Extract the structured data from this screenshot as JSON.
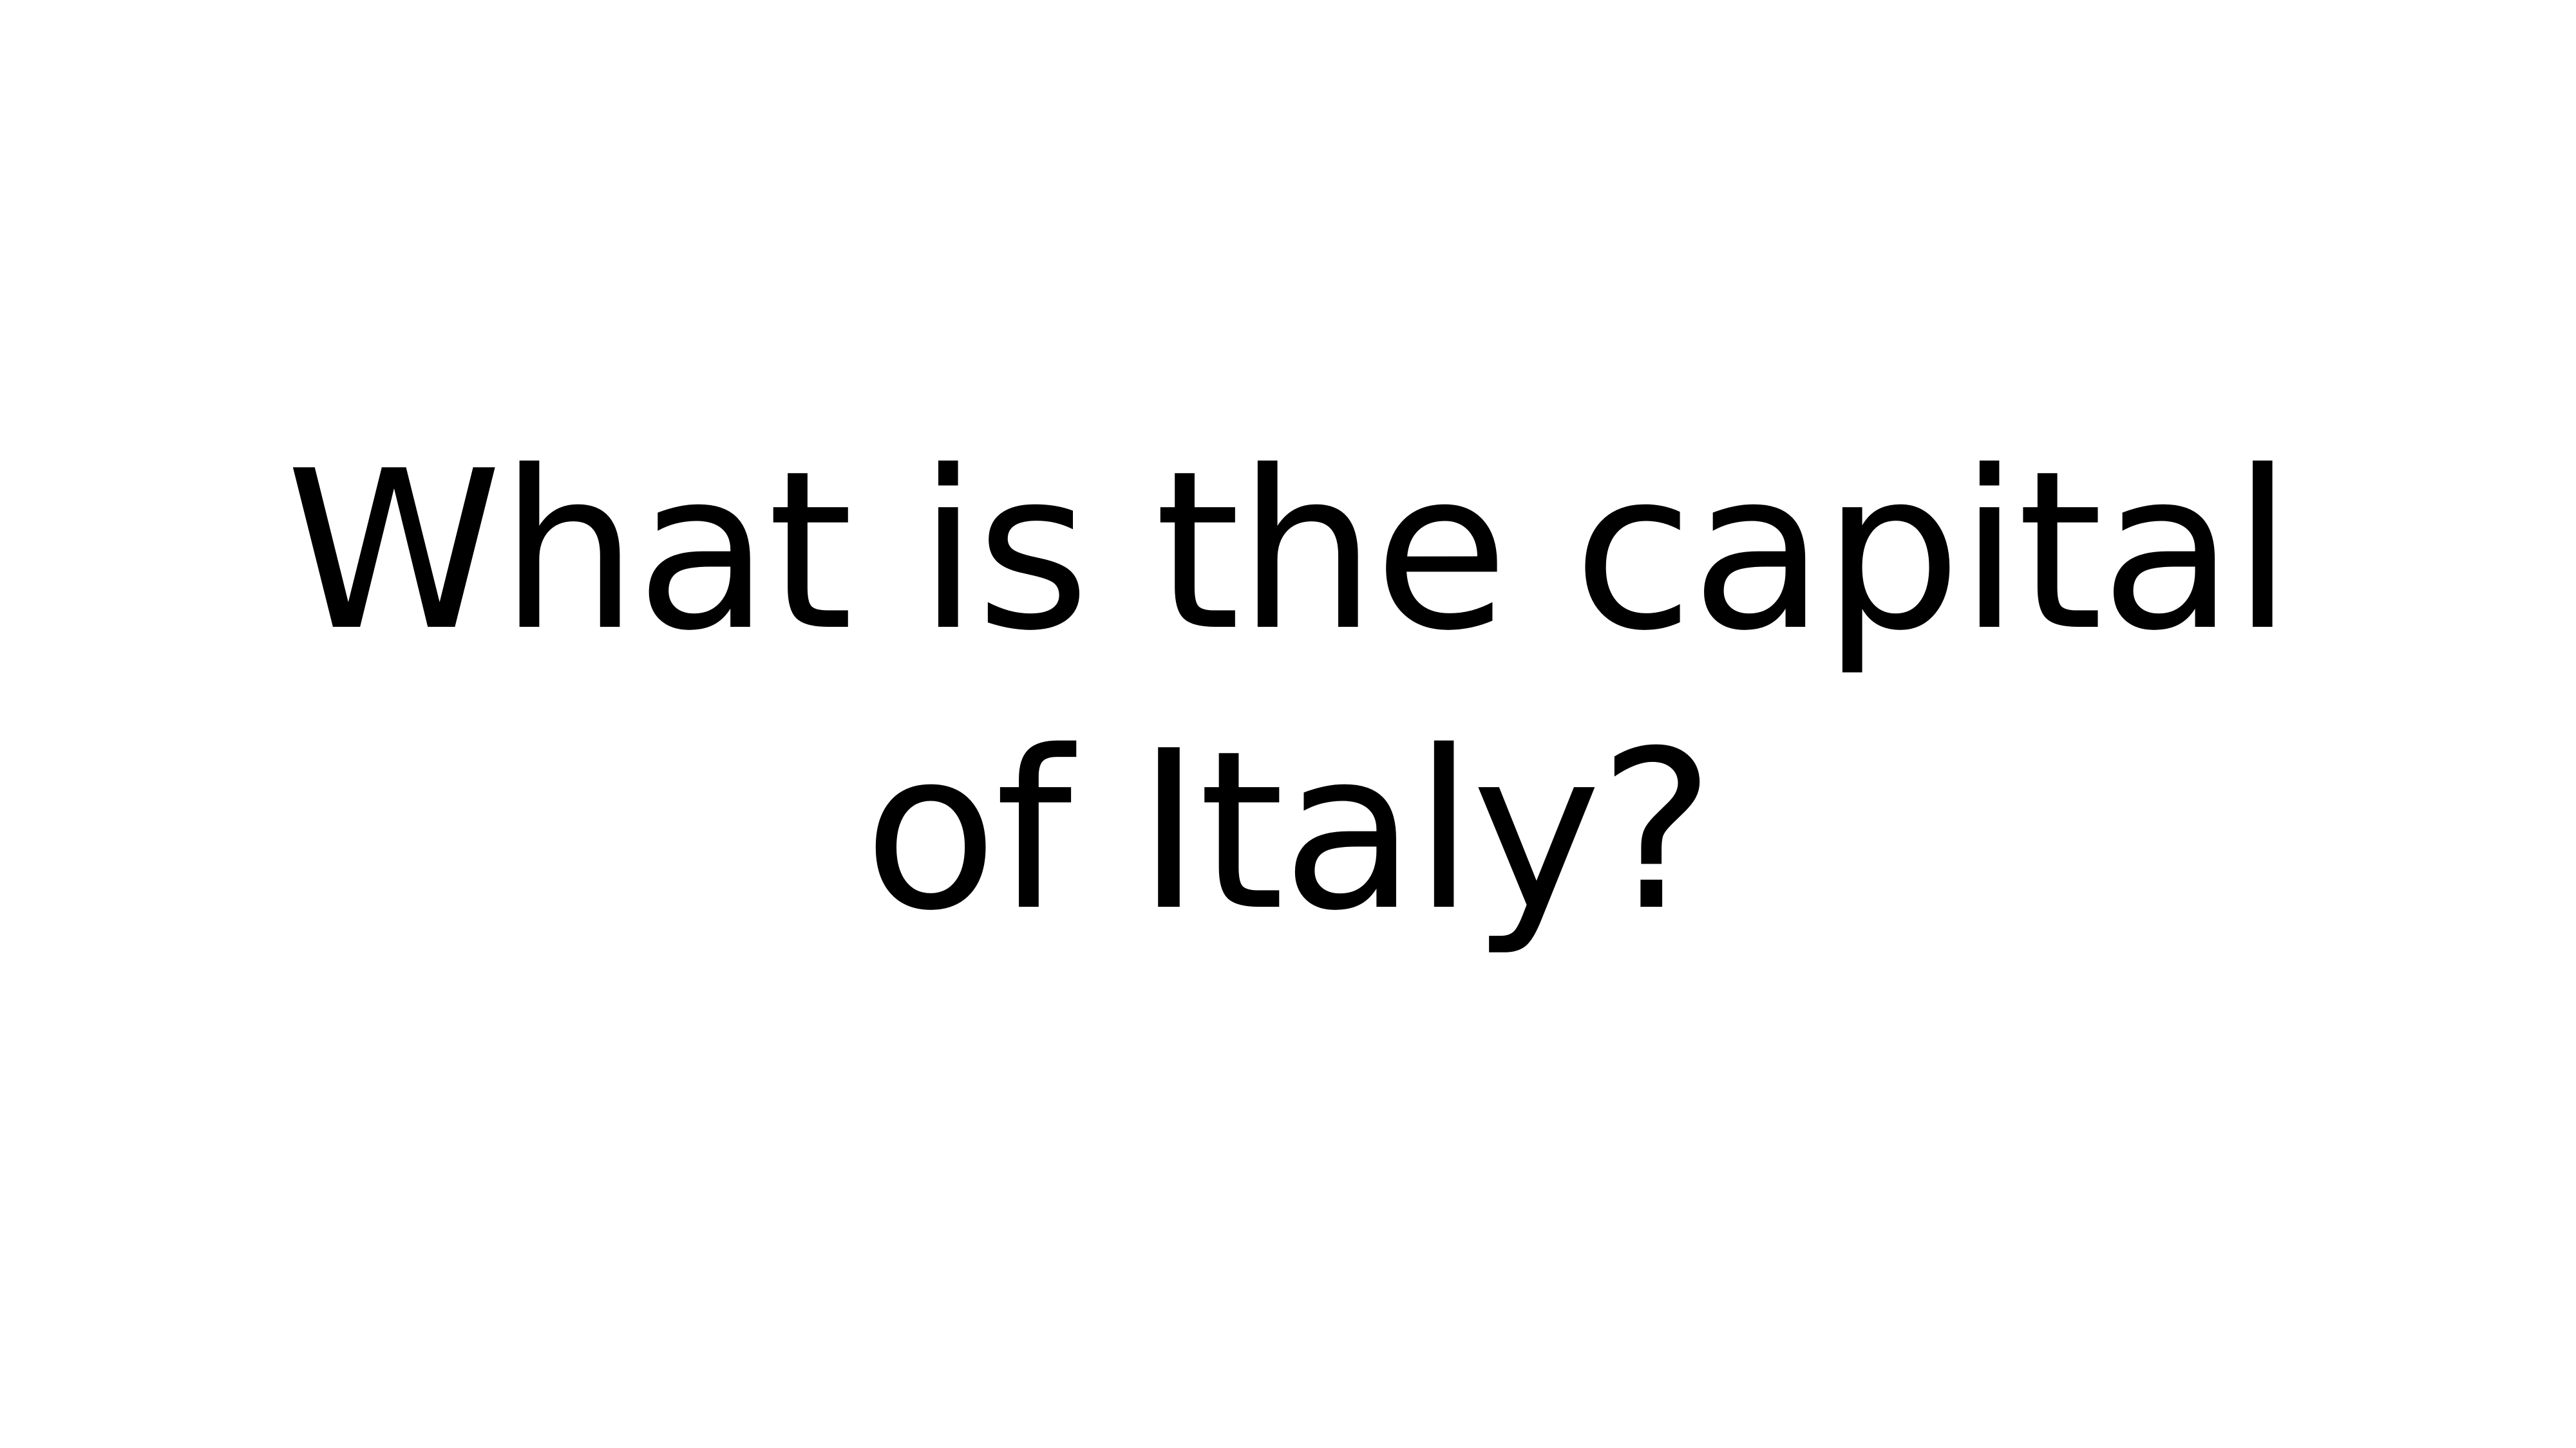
{
  "slide": {
    "question_lines": [
      "What is the capital",
      "of Italy?"
    ]
  },
  "colors": {
    "background": "#ffffff",
    "text": "#000000"
  }
}
